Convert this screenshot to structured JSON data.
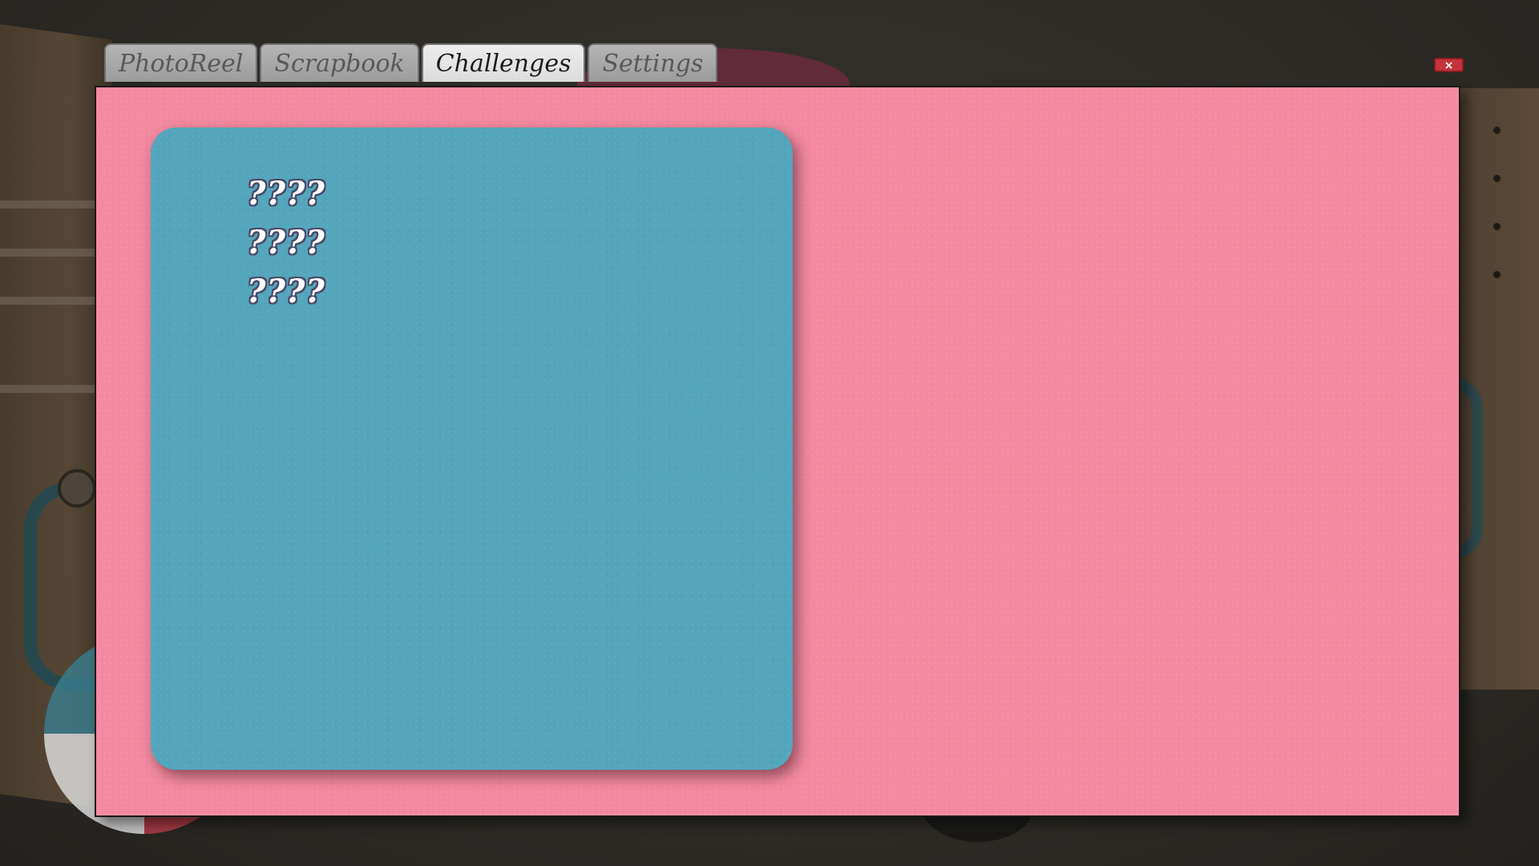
{
  "tabs": [
    {
      "label": "PhotoReel",
      "active": false
    },
    {
      "label": "Scrapbook",
      "active": false
    },
    {
      "label": "Challenges",
      "active": true
    },
    {
      "label": "Settings",
      "active": false
    }
  ],
  "close_button": {
    "label": "×",
    "color": "#c3353b"
  },
  "panel": {
    "background": "#f48aa1"
  },
  "challenge_card": {
    "background": "#54a6bc",
    "items": [
      {
        "label": "????"
      },
      {
        "label": "????"
      },
      {
        "label": "????"
      }
    ]
  }
}
